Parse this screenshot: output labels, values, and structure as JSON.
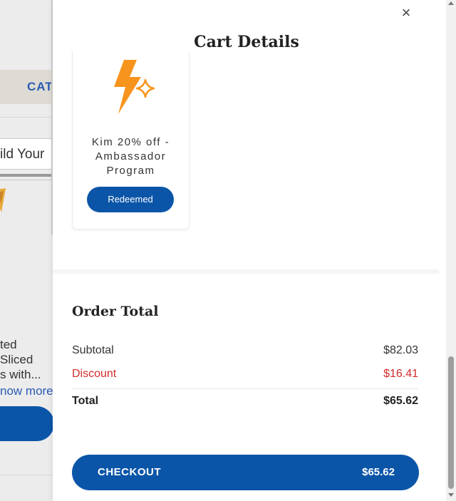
{
  "background_page": {
    "category_tab": "CAT",
    "build_label": "ild Your",
    "description_lines": [
      "ted",
      "Sliced",
      "s with..."
    ],
    "show_more": "now more"
  },
  "cart": {
    "title": "Cart Details",
    "close_icon": "close-icon",
    "offer": {
      "icon": "lightning-sparkle-icon",
      "title_line1": "Kim 20% off -",
      "title_line2": "Ambassador",
      "title_line3": "Program",
      "button_label": "Redeemed"
    },
    "order_total": {
      "heading": "Order Total",
      "subtotal_label": "Subtotal",
      "subtotal_value": "$82.03",
      "discount_label": "Discount",
      "discount_value": "$16.41",
      "total_label": "Total",
      "total_value": "$65.62"
    },
    "checkout": {
      "label": "CHECKOUT",
      "amount": "$65.62"
    }
  },
  "colors": {
    "brand_blue": "#0b55a8",
    "discount_red": "#d32a2a",
    "icon_orange": "#f7941d"
  }
}
